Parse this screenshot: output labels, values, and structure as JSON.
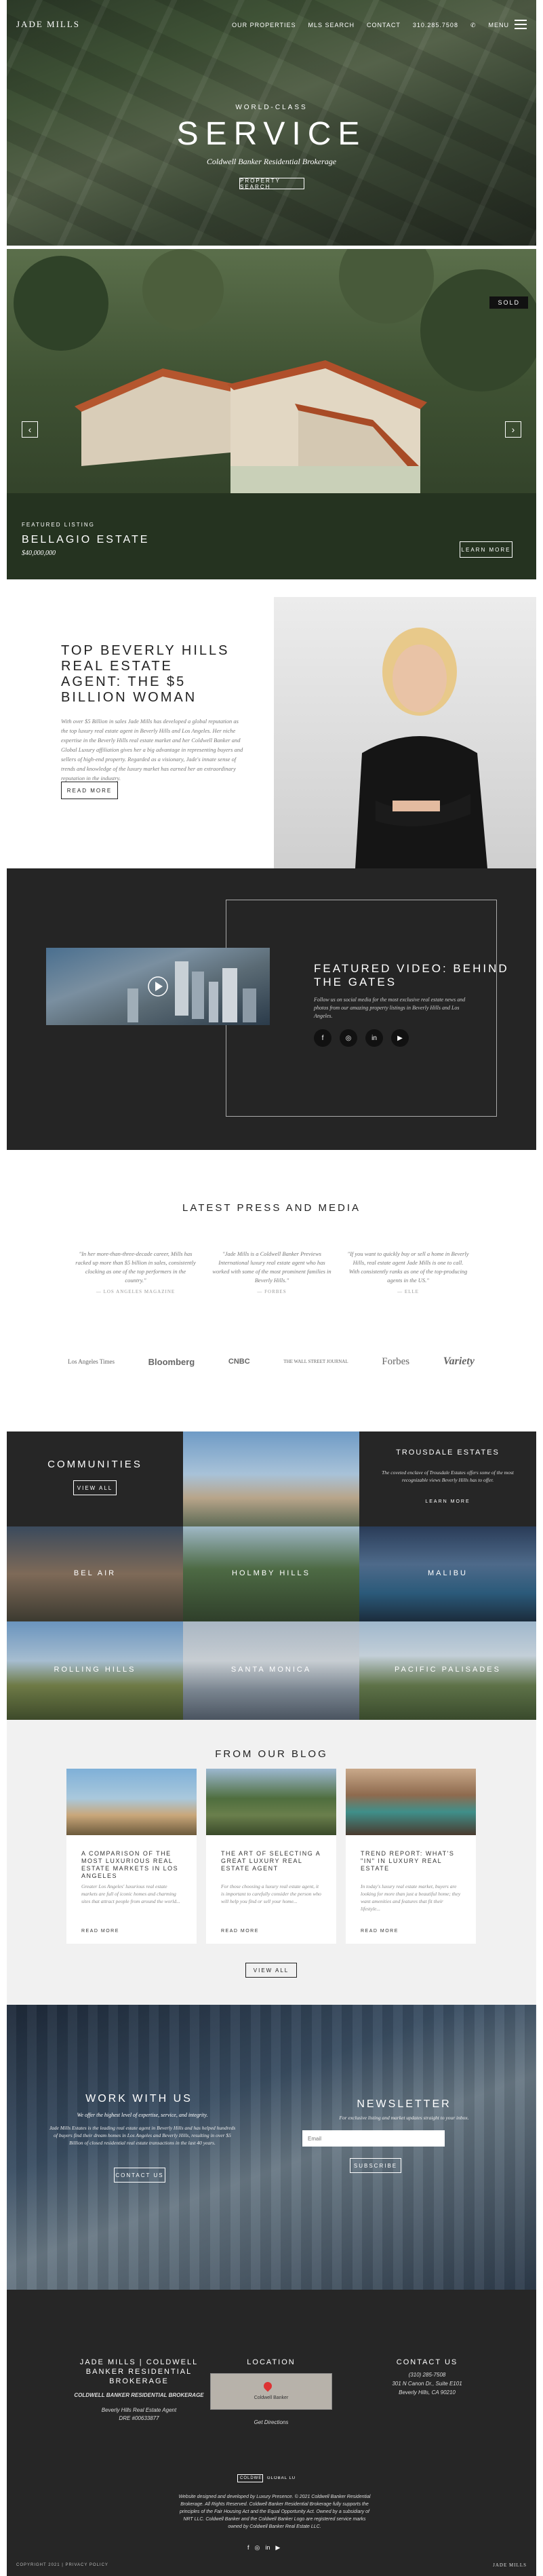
{
  "nav": {
    "logo": "JADE MILLS",
    "items": [
      "OUR PROPERTIES",
      "MLS SEARCH",
      "CONTACT"
    ],
    "phone": "310.285.7508",
    "menu_label": "MENU"
  },
  "hero": {
    "kicker": "WORLD-CLASS",
    "title": "SERVICE",
    "subtitle": "Coldwell Banker Residential Brokerage",
    "button": "PROPERTY SEARCH"
  },
  "estate": {
    "badge": "SOLD",
    "label": "FEATURED LISTING",
    "name": "BELLAGIO ESTATE",
    "price": "$40,000,000",
    "button": "LEARN MORE",
    "prev": "‹",
    "next": "›"
  },
  "agent": {
    "heading": "TOP BEVERLY HILLS REAL ESTATE AGENT: THE $5 BILLION WOMAN",
    "body": "With over $5 Billion in sales Jade Mills has developed a global reputation as the top luxury real estate agent in Beverly Hills and Los Angeles. Her niche expertise in the Beverly Hills real estate market and her Coldwell Banker and Global Luxury affiliation gives her a big advantage in representing buyers and sellers of high-end property. Regarded as a visionary, Jade's innate sense of trends and knowledge of the luxury market has earned her an extraordinary reputation in the industry.",
    "button": "READ MORE"
  },
  "video": {
    "heading": "FEATURED VIDEO: BEHIND THE GATES",
    "body": "Follow us on social media for the most exclusive real estate news and photos from our amazing property listings in Beverly Hills and Los Angeles.",
    "social": [
      "f",
      "◎",
      "in",
      "▶"
    ]
  },
  "press": {
    "heading": "LATEST PRESS AND MEDIA",
    "quotes": [
      {
        "text": "\"In her more-than-three-decade career, Mills has racked up more than $5 billion in sales, consistently clocking as one of the top performers in the country.\"",
        "source": "— LOS ANGELES MAGAZINE"
      },
      {
        "text": "\"Jade Mills is a Coldwell Banker Previews International luxury real estate agent who has worked with some of the most prominent families in Beverly Hills.\"",
        "source": "— FORBES"
      },
      {
        "text": "\"If you want to quickly buy or sell a home in Beverly Hills, real estate agent Jade Mills is one to call. With consistently ranks as one of the top-producing agents in the US.\"",
        "source": "— ELLE"
      }
    ],
    "logos": [
      "Los Angeles Times",
      "Bloomberg",
      "CNBC",
      "THE WALL STREET JOURNAL",
      "Forbes",
      "Variety"
    ]
  },
  "communities": {
    "heading": "COMMUNITIES",
    "button": "VIEW ALL",
    "featured": "TROUSDALE ESTATES",
    "featured_text": "The coveted enclave of Trousdale Estates offers some of the most recognizable views Beverly Hills has to offer.",
    "featured_button": "LEARN MORE",
    "tiles": [
      "BEL AIR",
      "HOLMBY HILLS",
      "MALIBU",
      "ROLLING HILLS",
      "SANTA MONICA",
      "PACIFIC PALISADES"
    ]
  },
  "blog": {
    "heading": "FROM OUR BLOG",
    "posts": [
      {
        "title": "A COMPARISON OF THE MOST LUXURIOUS REAL ESTATE MARKETS IN LOS ANGELES",
        "excerpt": "Greater Los Angeles' luxurious real estate markets are full of iconic homes and charming sites that attract people from around the world...",
        "read": "READ MORE"
      },
      {
        "title": "THE ART OF SELECTING A GREAT LUXURY REAL ESTATE AGENT",
        "excerpt": "For those choosing a luxury real estate agent, it is important to carefully consider the person who will help you find or sell your home...",
        "read": "READ MORE"
      },
      {
        "title": "TREND REPORT: WHAT'S \"IN\" IN LUXURY REAL ESTATE",
        "excerpt": "In today's luxury real estate market, buyers are looking for more than just a beautiful home; they want amenities and features that fit their lifestyle...",
        "read": "READ MORE"
      }
    ],
    "button": "VIEW ALL"
  },
  "work": {
    "heading": "WORK WITH US",
    "sub": "We offer the highest level of expertise, service, and integrity.",
    "body": "Jade Mills Estates is the leading real estate agent in Beverly Hills and has helped hundreds of buyers find their dream homes in Los Angeles and Beverly Hills, resulting in over $5 Billion of closed residential real estate transactions in the last 40 years.",
    "button": "CONTACT US",
    "newsletter_heading": "NEWSLETTER",
    "newsletter_sub": "For exclusive listing and market updates straight to your inbox.",
    "email_placeholder": "Email",
    "newsletter_button": "SUBSCRIBE"
  },
  "footer": {
    "brand": "JADE MILLS | COLDWELL BANKER RESIDENTIAL BROKERAGE",
    "brand_sub": "COLDWELL BANKER RESIDENTIAL BROKERAGE",
    "brand_lines": [
      "Beverly Hills Real Estate Agent",
      "DRE #00633877"
    ],
    "location_heading": "LOCATION",
    "map_label": "Coldwell Banker",
    "directions": "Get Directions",
    "contact_heading": "CONTACT US",
    "contact_lines": [
      "(310) 285-7508",
      "301 N Canon Dr., Suite E101",
      "Beverly Hills, CA 90210"
    ],
    "partner_logos": [
      "COLDWELL BANKER",
      "GLOBAL LUXURY"
    ],
    "legal": "Website designed and developed by Luxury Presence. © 2021 Coldwell Banker Residential Brokerage. All Rights Reserved. Coldwell Banker Residential Brokerage fully supports the principles of the Fair Housing Act and the Equal Opportunity Act. Owned by a subsidiary of NRT LLC. Coldwell Banker and the Coldwell Banker Logo are registered service marks owned by Coldwell Banker Real Estate LLC.",
    "social": [
      "f",
      "◎",
      "in",
      "▶"
    ],
    "copyright": "COPYRIGHT 2021 | PRIVACY POLICY",
    "bottom_logo": "JADE MILLS"
  }
}
